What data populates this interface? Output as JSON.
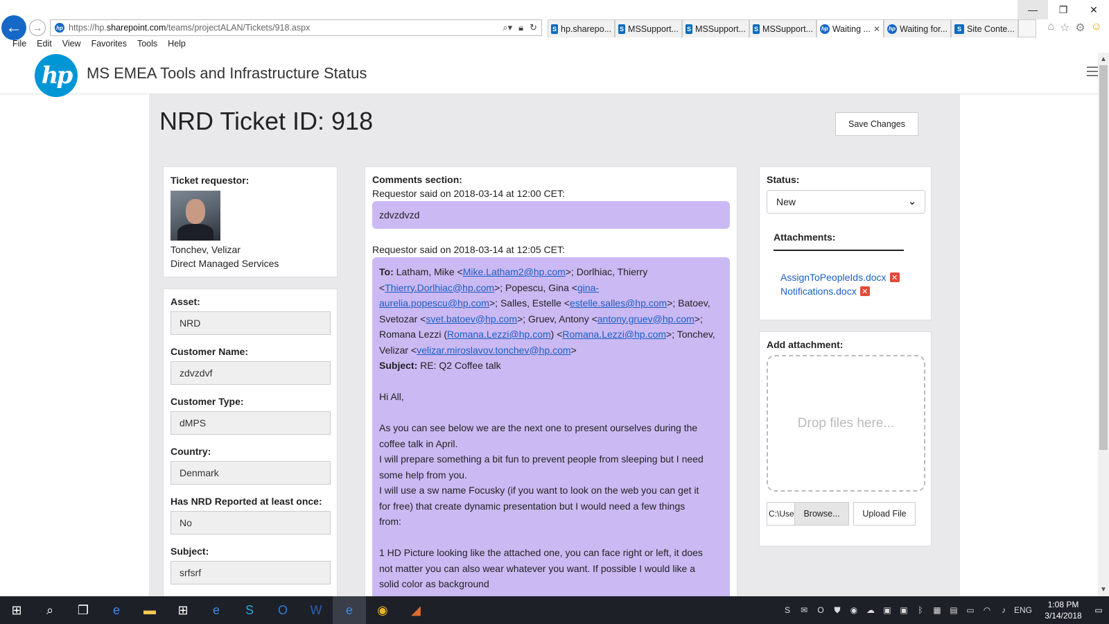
{
  "browser": {
    "url_prefix": "https://hp.",
    "url_domain": "sharepoint.com",
    "url_path": "/teams/projectALAN/Tickets/918.aspx",
    "tabs": [
      {
        "icon": "sharepoint",
        "label": "hp.sharepo..."
      },
      {
        "icon": "sharepoint",
        "label": "MSSupport..."
      },
      {
        "icon": "sharepoint",
        "label": "MSSupport..."
      },
      {
        "icon": "sharepoint",
        "label": "MSSupport..."
      },
      {
        "icon": "hp",
        "label": "Waiting ...",
        "active": true
      },
      {
        "icon": "hp",
        "label": "Waiting for..."
      },
      {
        "icon": "sharepoint",
        "label": "Site Conte..."
      }
    ],
    "menu": [
      "File",
      "Edit",
      "View",
      "Favorites",
      "Tools",
      "Help"
    ]
  },
  "site": {
    "logo_text": "hp",
    "title": "MS EMEA Tools and Infrastructure Status"
  },
  "ticket": {
    "title": "NRD Ticket ID: 918",
    "save_label": "Save Changes"
  },
  "requestor": {
    "label": "Ticket requestor:",
    "name": "Tonchev, Velizar",
    "department": "Direct Managed Services"
  },
  "fields": [
    {
      "label": "Asset:",
      "value": "NRD"
    },
    {
      "label": "Customer Name:",
      "value": "zdvzdvf"
    },
    {
      "label": "Customer Type:",
      "value": "dMPS"
    },
    {
      "label": "Country:",
      "value": "Denmark"
    },
    {
      "label": "Has NRD Reported at least once:",
      "value": "No"
    },
    {
      "label": "Subject:",
      "value": "srfsrf"
    }
  ],
  "comments": {
    "label": "Comments section:",
    "first": {
      "header": "Requestor said on 2018-03-14 at 12:00 CET:",
      "text": "zdvzdvzd"
    },
    "second": {
      "header": "Requestor said on 2018-03-14 at 12:05 CET:",
      "to_label": "To:",
      "to_line1_a": " Latham, Mike <",
      "to_link1": "Mike.Latham2@hp.com",
      "to_line1_b": ">; Dorlhiac, Thierry",
      "to_line2_a": "<",
      "to_link2": "Thierry.Dorlhiac@hp.com",
      "to_line2_b": ">; Popescu, Gina <",
      "to_link3a": "gina-",
      "to_link3b": "aurelia.popescu@hp.com",
      "to_line3_b": ">; Salles, Estelle <",
      "to_link4": "estelle.salles@hp.com",
      "to_line3_c": ">; Batoev,",
      "to_line4_a": "Svetozar <",
      "to_link5": "svet.batoev@hp.com",
      "to_line4_b": ">; Gruev, Antony <",
      "to_link6": "antony.gruev@hp.com",
      "to_line4_c": ">;",
      "to_line5_a": "Romana Lezzi (",
      "to_link7": "Romana.Lezzi@hp.com",
      "to_line5_b": ") <",
      "to_link8": "Romana.Lezzi@hp.com",
      "to_line5_c": ">; Tonchev,",
      "to_line6_a": "Velizar <",
      "to_link9": "velizar.miroslavov.tonchev@hp.com",
      "to_line6_b": ">",
      "subject_label": "Subject:",
      "subject": " RE: Q2 Coffee talk",
      "body": [
        "Hi All,",
        "",
        "As you can see below we are the next one to present ourselves during the",
        "coffee talk in April.",
        "I will prepare something a bit fun to prevent people from sleeping but I need",
        "some help from you.",
        "I will use a sw name Focusky (if you want to look on the web you can get it",
        "for free) that create dynamic presentation but I would need a few things",
        "from:",
        "",
        "1 HD Picture looking like the attached one, you can face right or left, it does",
        "not matter you can also wear whatever you want. If possible I would like a",
        "solid color as background"
      ]
    }
  },
  "status": {
    "label": "Status:",
    "value": "New",
    "attachments_label": "Attachments:",
    "attachments": [
      "AssignToPeopleIds.docx",
      "Notifications.docx"
    ]
  },
  "add_attachment": {
    "label": "Add attachment:",
    "dropzone_text": "Drop files here...",
    "file_path": "C:\\Use",
    "browse_label": "Browse...",
    "upload_label": "Upload File"
  },
  "taskbar": {
    "language": "ENG",
    "time": "1:08 PM",
    "date": "3/14/2018"
  }
}
